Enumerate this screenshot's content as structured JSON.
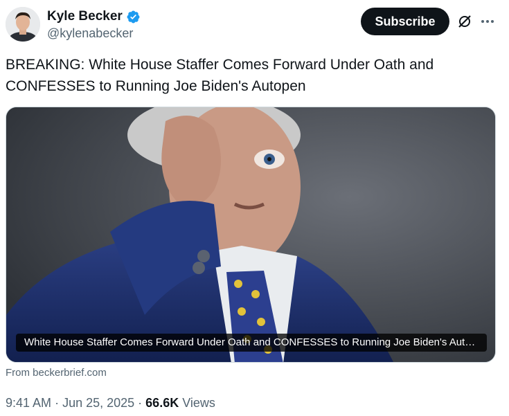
{
  "author": {
    "display_name": "Kyle Becker",
    "handle": "@kylenabecker",
    "verified": true
  },
  "actions": {
    "subscribe_label": "Subscribe",
    "grok_icon": "grok-icon",
    "more_icon": "more-icon"
  },
  "tweet": {
    "text": "BREAKING: White House Staffer Comes Forward Under Oath and CONFESSES to Running Joe Biden's Autopen"
  },
  "card": {
    "title": "White House Staffer Comes Forward Under Oath and CONFESSES to Running Joe Biden's Autopen",
    "source": "From beckerbrief.com"
  },
  "meta": {
    "time": "9:41 AM",
    "date": "Jun 25, 2025",
    "views_count": "66.6K",
    "views_label": "Views"
  },
  "colors": {
    "text_primary": "#0f1419",
    "text_secondary": "#536471",
    "verified_blue": "#1d9bf0",
    "button_dark": "#0f1419"
  }
}
